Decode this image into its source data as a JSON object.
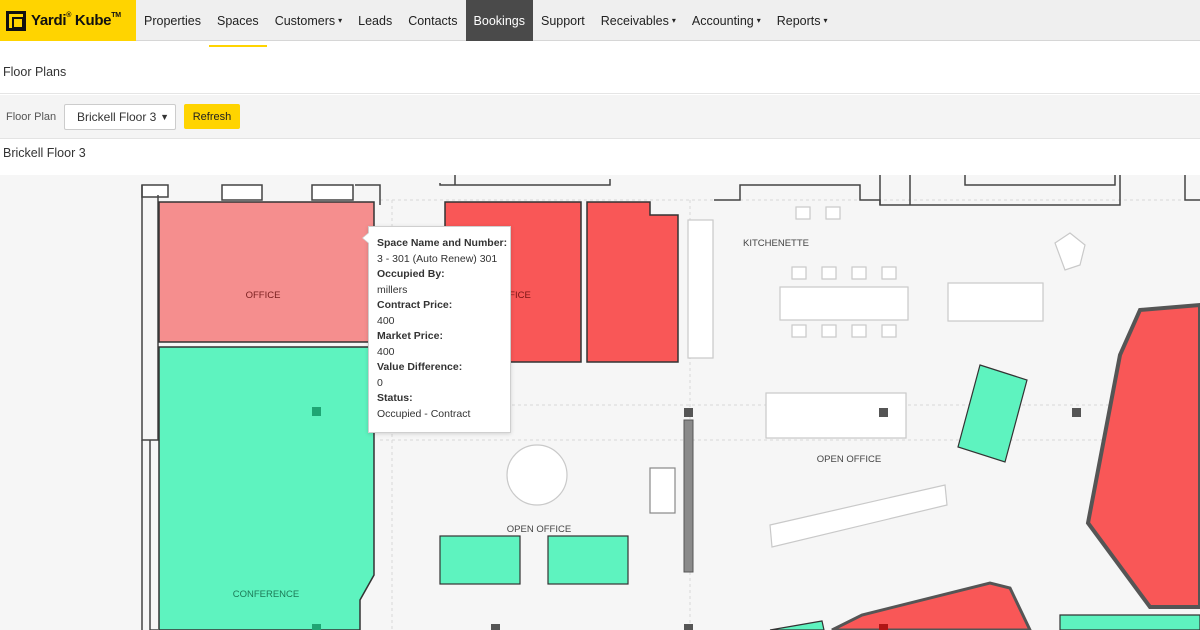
{
  "nav": {
    "logo": "Yardi",
    "logo_product": "Kube",
    "logo_reg": "®",
    "logo_tm": "TM",
    "items": [
      {
        "label": "Properties",
        "caret": ""
      },
      {
        "label": "Spaces",
        "caret": ""
      },
      {
        "label": "Customers",
        "caret": "▾"
      },
      {
        "label": "Leads",
        "caret": ""
      },
      {
        "label": "Contacts",
        "caret": ""
      },
      {
        "label": "Bookings",
        "caret": ""
      },
      {
        "label": "Support",
        "caret": ""
      },
      {
        "label": "Receivables",
        "caret": "▾"
      },
      {
        "label": "Accounting",
        "caret": "▾"
      },
      {
        "label": "Reports",
        "caret": "▾"
      }
    ]
  },
  "page": {
    "title": "Floor Plans",
    "filter_label": "Floor Plan",
    "select_value": "Brickell Floor 3",
    "refresh_label": "Refresh",
    "section_title": "Brickell Floor 3"
  },
  "plan": {
    "labels": {
      "office1": "OFFICE",
      "office2": "FICE",
      "kitchenette": "KITCHENETTE",
      "open_office1": "OPEN OFFICE",
      "open_office2": "OPEN OFFICE",
      "conference": "CONFERENCE"
    },
    "colors": {
      "occupied_light": "#f58e8e",
      "occupied": "#f95757",
      "available": "#5ef3bf",
      "wall": "#444444"
    }
  },
  "tooltip": {
    "name_label": "Space Name and Number:",
    "name_value": "3 - 301 (Auto Renew) 301",
    "occupied_label": "Occupied By:",
    "occupied_value": "millers",
    "contract_label": "Contract Price:",
    "contract_value": "400",
    "market_label": "Market Price:",
    "market_value": "400",
    "diff_label": "Value Difference:",
    "diff_value": "0",
    "status_label": "Status:",
    "status_value": "Occupied - Contract"
  }
}
